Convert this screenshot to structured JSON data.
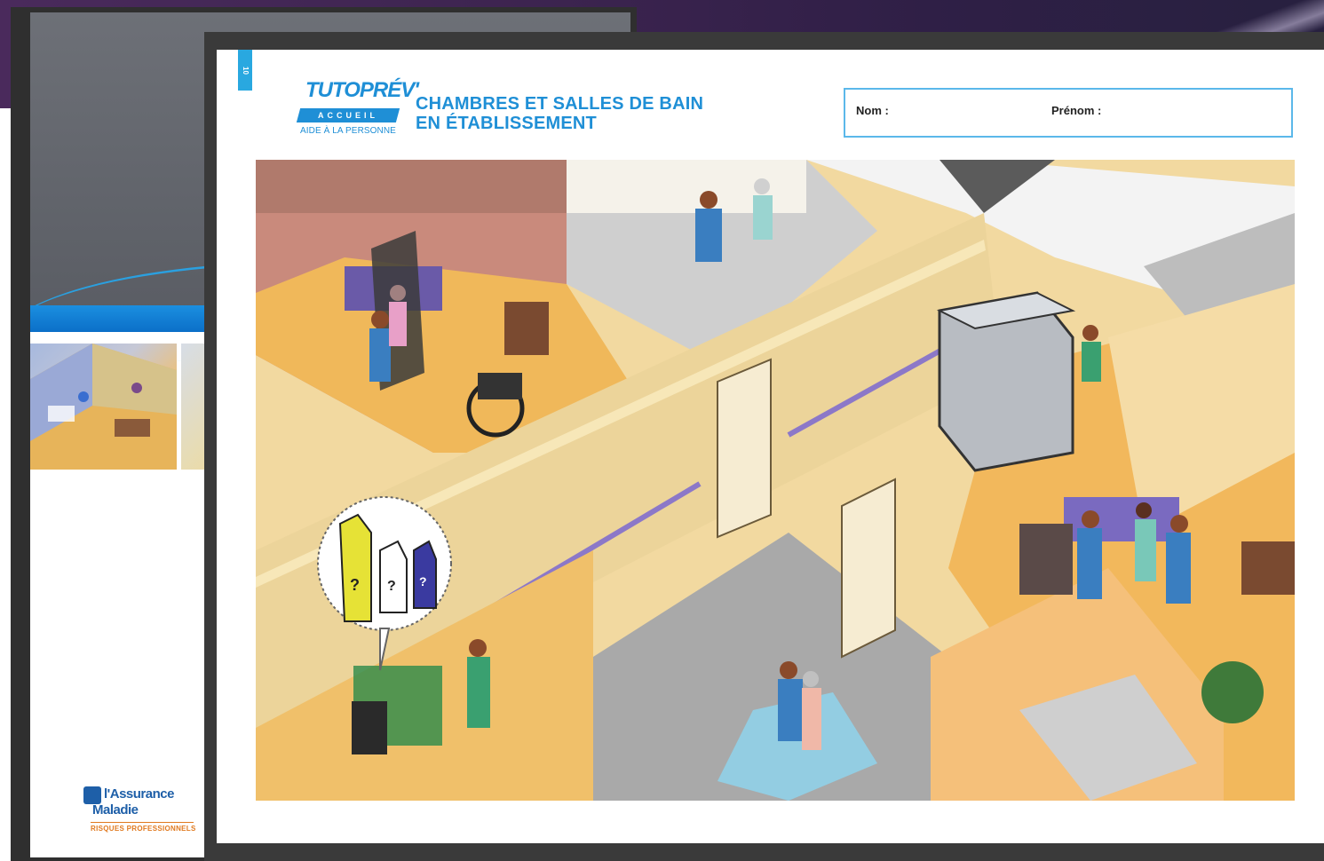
{
  "back_cover": {
    "logo_line1": "l'Assurance",
    "logo_line2": "Maladie",
    "logo_line3": "RISQUES PROFESSIONNELS"
  },
  "worksheet": {
    "page_number": "10",
    "brand_name": "TUTOPRÉV'",
    "brand_ribbon": "ACCUEIL",
    "brand_subtitle": "AIDE À LA PERSONNE",
    "title_line1": "CHAMBRES ET SALLES DE BAIN",
    "title_line2": "EN ÉTABLISSEMENT",
    "name_label": "Nom :",
    "firstname_label": "Prénom :"
  },
  "illustration": {
    "icons": [
      "question-bottle-icon",
      "question-spray-icon",
      "question-spray-icon"
    ]
  },
  "colors": {
    "accent_blue": "#1f8fd6",
    "header_purple": "#3d2450",
    "floor_wood": "#f0b85a",
    "corridor_purple": "#8c78c8"
  }
}
